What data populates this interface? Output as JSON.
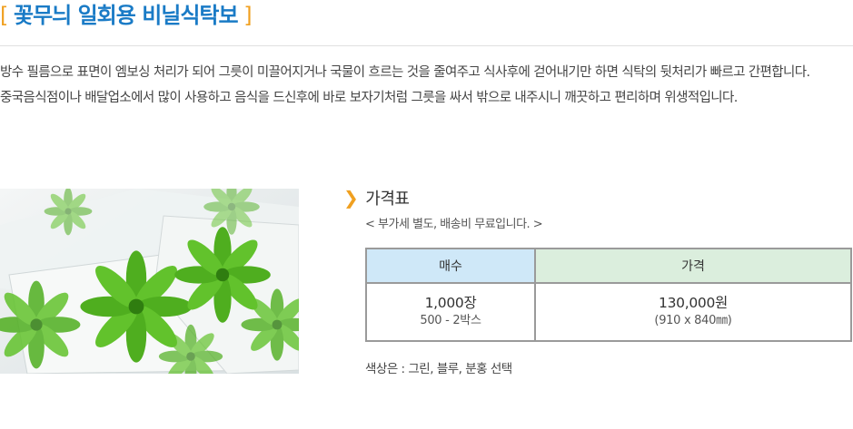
{
  "page": {
    "title_open": "[ ",
    "title_text": "꽃무늬 일회용 비닐식탁보",
    "title_close": " ]"
  },
  "description": {
    "para1": "방수 필름으로 표면이 엠보싱 처리가 되어 그릇이 미끌어지거나 국물이 흐르는 것을 줄여주고 식사후에 걷어내기만 하면 식탁의 뒷처리가 빠르고 간편합니다.",
    "para2": "중국음식점이나 배달업소에서 많이 사용하고 음식을 드신후에 바로 보자기처럼 그릇을 싸서 밖으로 내주시니 깨끗하고 편리하며 위생적입니다."
  },
  "price_section": {
    "title": "가격표",
    "note": "< 부가세 별도, 배송비 무료입니다. >",
    "table": {
      "headers": [
        "매수",
        "가격"
      ],
      "rows": [
        {
          "qty_main": "1,000장",
          "qty_sub": "500 - 2박스",
          "price_main": "130,000원",
          "price_sub": "(910 x 840㎜)"
        }
      ]
    },
    "color_note": "색상은 : 그린, 블루, 분홍 선택"
  },
  "colors": {
    "title_blue": "#1a7bc6",
    "bracket_orange": "#f0a020",
    "header_blue": "#cfe8f8",
    "header_green": "#dbeedd",
    "leaf_green": "#5cb82a"
  },
  "icons": {
    "section_marker": "chevron-right-icon"
  }
}
